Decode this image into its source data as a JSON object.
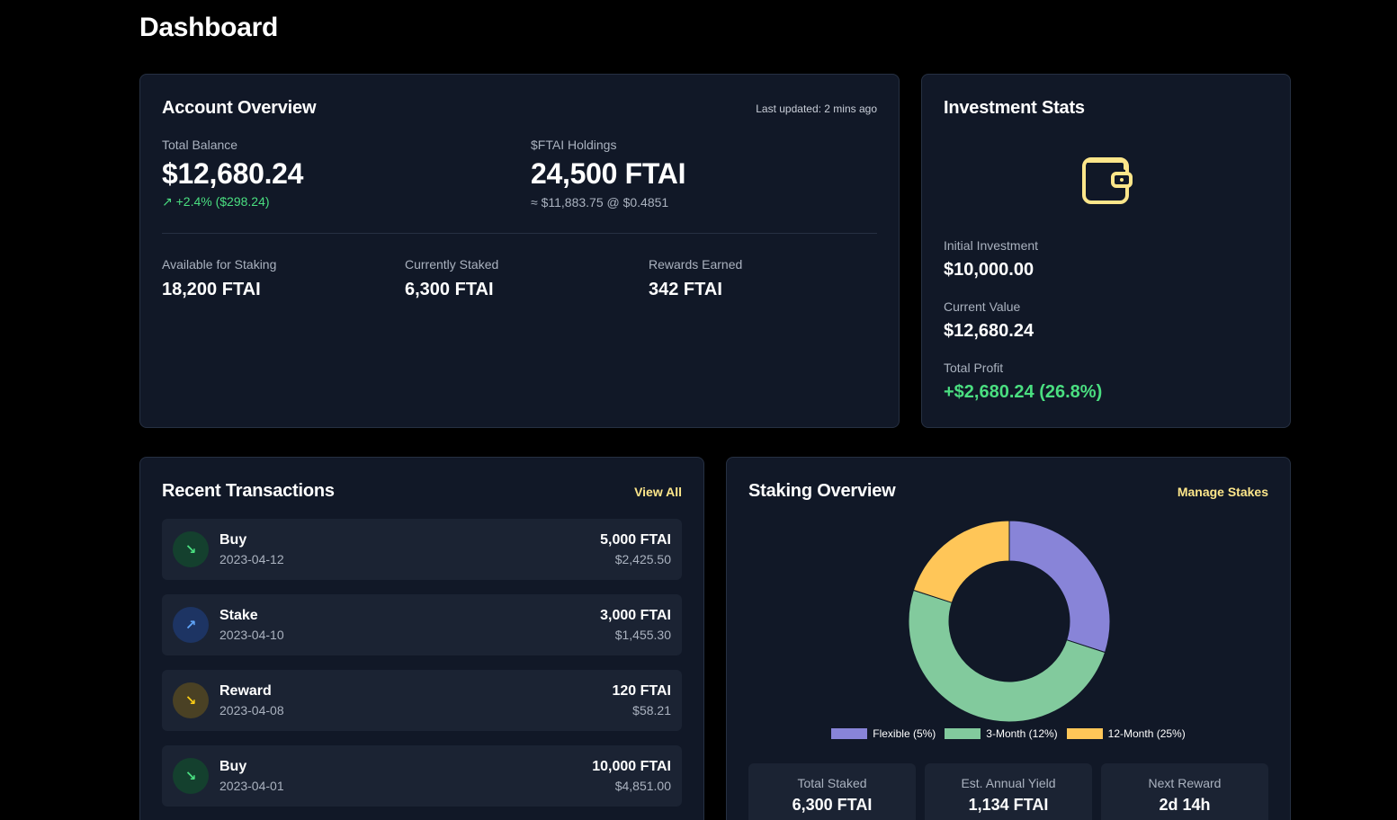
{
  "page": {
    "title": "Dashboard"
  },
  "account": {
    "title": "Account Overview",
    "last_updated": "Last updated: 2 mins ago",
    "total_balance_label": "Total Balance",
    "total_balance": "$12,680.24",
    "change_icon": "↗",
    "change": "+2.4% ($298.24)",
    "holdings_label": "$FTAI Holdings",
    "holdings": "24,500 FTAI",
    "holdings_sub": "≈ $11,883.75 @ $0.4851",
    "available_label": "Available for Staking",
    "available": "18,200 FTAI",
    "staked_label": "Currently Staked",
    "staked": "6,300 FTAI",
    "rewards_label": "Rewards Earned",
    "rewards": "342 FTAI"
  },
  "investment": {
    "title": "Investment Stats",
    "icon": "wallet-icon",
    "initial_label": "Initial Investment",
    "initial": "$10,000.00",
    "current_label": "Current Value",
    "current": "$12,680.24",
    "profit_label": "Total Profit",
    "profit": "+$2,680.24 (26.8%)"
  },
  "transactions": {
    "title": "Recent Transactions",
    "view_all": "View All",
    "items": [
      {
        "type": "Buy",
        "date": "2023-04-12",
        "amount": "5,000 FTAI",
        "usd": "$2,425.50",
        "icon": "arrow-down-right-icon",
        "glyph": "↘",
        "color": "#4ade80",
        "bg": "#14402e"
      },
      {
        "type": "Stake",
        "date": "2023-04-10",
        "amount": "3,000 FTAI",
        "usd": "$1,455.30",
        "icon": "arrow-up-right-icon",
        "glyph": "↗",
        "color": "#60a5fa",
        "bg": "#1d3463"
      },
      {
        "type": "Reward",
        "date": "2023-04-08",
        "amount": "120 FTAI",
        "usd": "$58.21",
        "icon": "arrow-down-right-icon",
        "glyph": "↘",
        "color": "#facc15",
        "bg": "#4a4124"
      },
      {
        "type": "Buy",
        "date": "2023-04-01",
        "amount": "10,000 FTAI",
        "usd": "$4,851.00",
        "icon": "arrow-down-right-icon",
        "glyph": "↘",
        "color": "#4ade80",
        "bg": "#14402e"
      }
    ]
  },
  "staking": {
    "title": "Staking Overview",
    "manage": "Manage Stakes",
    "segments": [
      {
        "label": "Flexible (5%)",
        "value": 30,
        "color": "#8884d8"
      },
      {
        "label": "3-Month (12%)",
        "value": 50,
        "color": "#82ca9d"
      },
      {
        "label": "12-Month (25%)",
        "value": 20,
        "color": "#ffc658"
      }
    ],
    "total_staked_label": "Total Staked",
    "total_staked": "6,300 FTAI",
    "yield_label": "Est. Annual Yield",
    "yield": "1,134 FTAI",
    "next_reward_label": "Next Reward",
    "next_reward": "2d 14h"
  },
  "colors": {
    "accent": "#fde68a",
    "positive": "#4ade80",
    "card": "#111827"
  }
}
